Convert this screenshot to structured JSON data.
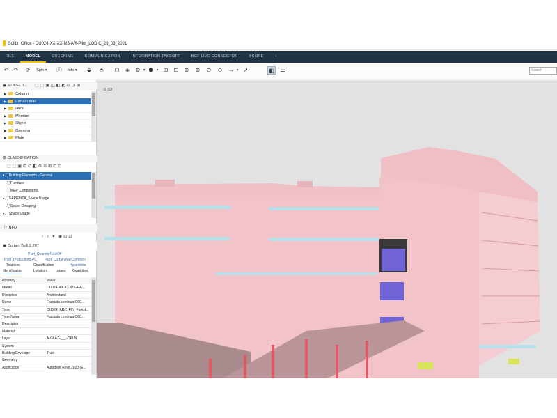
{
  "window": {
    "title": "Solibri Office - CU024-XX-XX-M3-AR-Pilot_LOD C_29_03_2021"
  },
  "menu": [
    {
      "label": "FILE"
    },
    {
      "label": "MODEL",
      "active": true
    },
    {
      "label": "CHECKING"
    },
    {
      "label": "COMMUNICATION"
    },
    {
      "label": "INFORMATION TAKEOFF"
    },
    {
      "label": "BCF LIVE CONNECTOR"
    },
    {
      "label": "SCORE"
    },
    {
      "label": "+"
    }
  ],
  "toolbar": {
    "spin_label": "Spin",
    "info_label": "Info",
    "search_placeholder": "Search"
  },
  "model_tree": {
    "title": "MODEL T...",
    "items": [
      {
        "label": "Column"
      },
      {
        "label": "Curtain Wall",
        "selected": true
      },
      {
        "label": "Door"
      },
      {
        "label": "Member"
      },
      {
        "label": "Object"
      },
      {
        "label": "Opening"
      },
      {
        "label": "Plate"
      }
    ]
  },
  "classification": {
    "title": "CLASSIFICATION",
    "items": [
      {
        "label": "Building Elements - General",
        "selected": true
      },
      {
        "label": "Furniture"
      },
      {
        "label": "MEP Components"
      },
      {
        "label": "SAPIENZA_Space Usage"
      },
      {
        "label": "Space Grouping"
      },
      {
        "label": "Space Usage"
      }
    ]
  },
  "info": {
    "title": "INFO",
    "element_name": "Curtain Wall:2.207",
    "tabs_row1": [
      "Pset_QuantityTakeOff"
    ],
    "tabs_row2": [
      "Pset_ProductInfo.PC",
      "Pset_CurtainWallCommon"
    ],
    "tabs_row3": [
      "Relations",
      "Classification",
      "Hyperlinks"
    ],
    "tabs_row4": [
      "Identification",
      "Location",
      "Issues",
      "Quantities"
    ],
    "header": {
      "property": "Property",
      "value": "Value"
    },
    "rows": [
      {
        "key": "Model",
        "value": "CU024-XX-XX-M3-AR-..."
      },
      {
        "key": "Discipline",
        "value": "Architectural"
      },
      {
        "key": "Name",
        "value": "Facciata continua:C60..."
      },
      {
        "key": "Type",
        "value": "CU024_ARC_FIN_Finest..."
      },
      {
        "key": "Type Name",
        "value": "Facciata continua:C60..."
      },
      {
        "key": "Description",
        "value": ""
      },
      {
        "key": "Material",
        "value": ""
      },
      {
        "key": "Layer",
        "value": "A-GLAZ-___-OPLN"
      },
      {
        "key": "System",
        "value": ""
      },
      {
        "key": "Building Envelope",
        "value": "True"
      },
      {
        "key": "Geometry",
        "value": ""
      },
      {
        "key": "Application",
        "value": "Autodesk Revit 2020 (E..."
      }
    ]
  },
  "viewport": {
    "label": "3D"
  },
  "colors": {
    "menubar": "#1f3344",
    "accent": "#f2c200",
    "selection": "#2b6fb5",
    "facade": "#f2c3c8",
    "glass": "#b8e0ea",
    "window_blue": "#6f63d6"
  }
}
